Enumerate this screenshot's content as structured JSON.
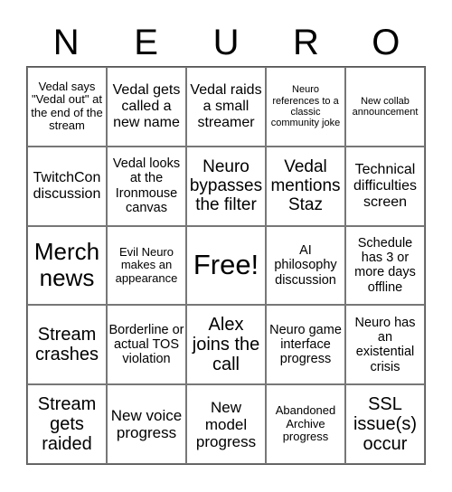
{
  "title_letters": [
    "N",
    "E",
    "U",
    "R",
    "O"
  ],
  "cells": [
    [
      "Vedal says \"Vedal out\" at the end of the stream",
      "Vedal gets called a new name",
      "Vedal raids a small streamer",
      "Neuro references to a classic community joke",
      "New collab announcement"
    ],
    [
      "TwitchCon discussion",
      "Vedal looks at the Ironmouse canvas",
      "Neuro bypasses the filter",
      "Vedal mentions Staz",
      "Technical difficulties screen"
    ],
    [
      "Merch news",
      "Evil Neuro makes an appearance",
      "Free!",
      "AI philosophy discussion",
      "Schedule has 3 or more days offline"
    ],
    [
      "Stream crashes",
      "Borderline or actual TOS violation",
      "Alex joins the call",
      "Neuro game interface progress",
      "Neuro has an existential crisis"
    ],
    [
      "Stream gets raided",
      "New voice progress",
      "New model progress",
      "Abandoned Archive progress",
      "SSL issue(s) occur"
    ]
  ]
}
